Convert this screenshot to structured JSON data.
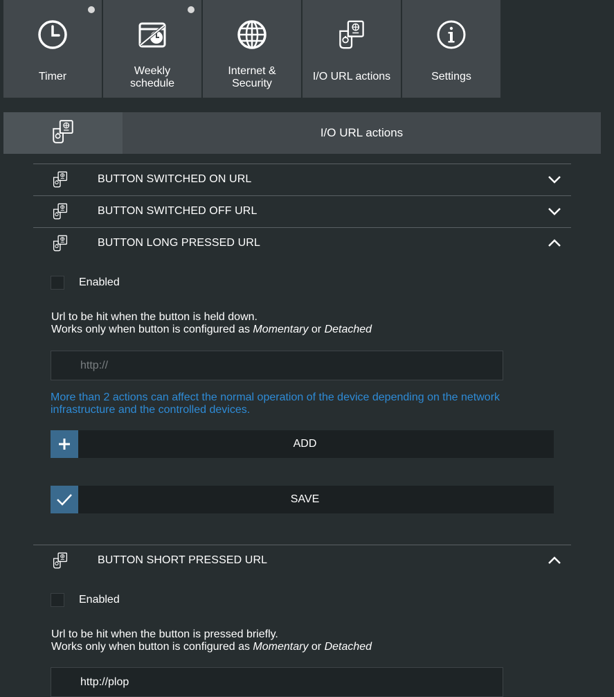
{
  "nav": {
    "tiles": [
      {
        "label": "Timer",
        "icon": "clock-icon",
        "dot": true
      },
      {
        "label": "Weekly\nschedule",
        "icon": "weekly-schedule-icon",
        "dot": true
      },
      {
        "label": "Internet &\nSecurity",
        "icon": "globe-icon",
        "dot": false
      },
      {
        "label": "I/O URL actions",
        "icon": "io-url-actions-icon",
        "dot": false
      },
      {
        "label": "Settings",
        "icon": "info-icon",
        "dot": false
      }
    ]
  },
  "section": {
    "title": "I/O URL actions",
    "icon": "io-url-actions-icon"
  },
  "actions": [
    {
      "label": "BUTTON SWITCHED ON URL",
      "expanded": false
    },
    {
      "label": "BUTTON SWITCHED OFF URL",
      "expanded": false
    },
    {
      "label": "BUTTON LONG PRESSED URL",
      "expanded": true,
      "enabled_label": "Enabled",
      "enabled": false,
      "desc_line1": "Url to be hit when the button is held down.",
      "desc_line2_prefix": "Works only when button is configured as ",
      "desc_mode1": "Momentary",
      "desc_or": " or ",
      "desc_mode2": "Detached",
      "url_value": "",
      "url_placeholder": "http://",
      "warning": "More than 2 actions can affect the normal operation of the device depending on the network infrastructure and the controlled devices.",
      "add_label": "ADD",
      "save_label": "SAVE"
    },
    {
      "label": "BUTTON SHORT PRESSED URL",
      "expanded": true,
      "enabled_label": "Enabled",
      "enabled": false,
      "desc_line1": "Url to be hit when the button is pressed briefly.",
      "desc_line2_prefix": "Works only when button is configured as ",
      "desc_mode1": "Momentary",
      "desc_or": " or ",
      "desc_mode2": "Detached",
      "url_value": "http://plop",
      "url_placeholder": "http://"
    }
  ],
  "colors": {
    "accent": "#3a6a8e",
    "warning_text": "#2e8bd6",
    "tile_bg": "#42484c",
    "page_bg": "#272e30"
  }
}
